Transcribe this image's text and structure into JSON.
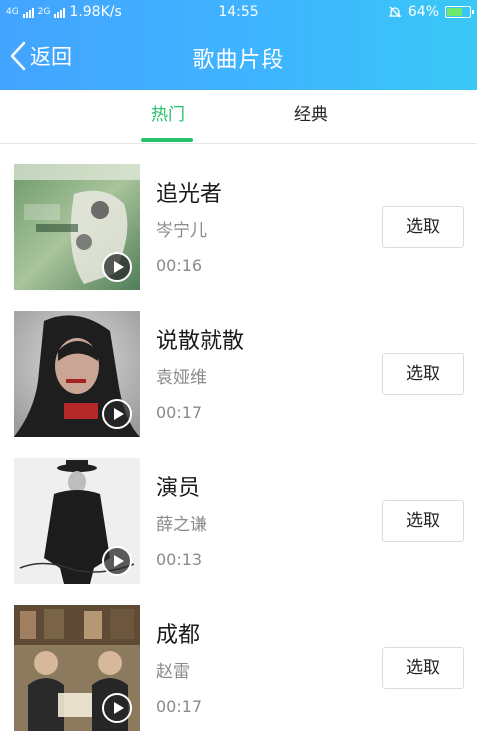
{
  "status_bar": {
    "network_label_top": "4G",
    "network_label_bottom": "2G",
    "speed": "1.98K/s",
    "time": "14:55",
    "battery": "64%"
  },
  "header": {
    "back_label": "返回",
    "title": "歌曲片段"
  },
  "tabs": [
    {
      "label": "热门",
      "active": true
    },
    {
      "label": "经典",
      "active": false
    }
  ],
  "songs": [
    {
      "title": "追光者",
      "artist": "岑宁儿",
      "duration": "00:16",
      "action_label": "选取"
    },
    {
      "title": "说散就散",
      "artist": "袁娅维",
      "duration": "00:17",
      "action_label": "选取"
    },
    {
      "title": "演员",
      "artist": "薛之谦",
      "duration": "00:13",
      "action_label": "选取"
    },
    {
      "title": "成都",
      "artist": "赵雷",
      "duration": "00:17",
      "action_label": "选取"
    }
  ],
  "colors": {
    "accent": "#25c26b",
    "header_gradient_start": "#43a4ff",
    "header_gradient_end": "#39c8f6"
  }
}
